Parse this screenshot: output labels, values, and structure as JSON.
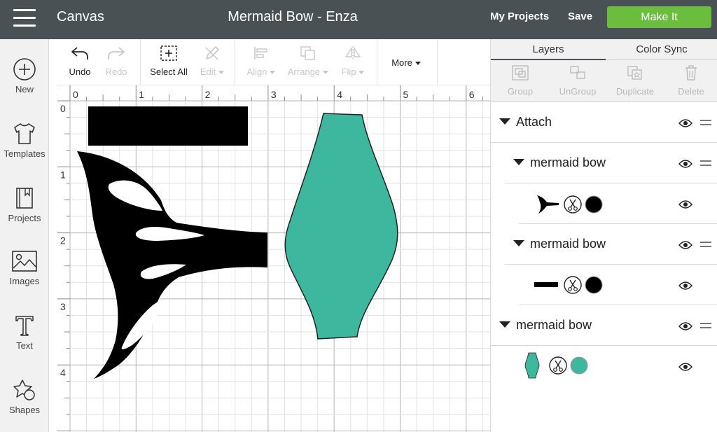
{
  "topbar": {
    "app_title": "Canvas",
    "project_title": "Mermaid Bow - Enza",
    "my_projects": "My Projects",
    "save": "Save",
    "make_it": "Make It"
  },
  "leftbar": {
    "items": [
      {
        "label": "New",
        "icon": "plus-circle-icon"
      },
      {
        "label": "Templates",
        "icon": "tshirt-icon"
      },
      {
        "label": "Projects",
        "icon": "book-icon"
      },
      {
        "label": "Images",
        "icon": "image-icon"
      },
      {
        "label": "Text",
        "icon": "text-icon"
      },
      {
        "label": "Shapes",
        "icon": "shapes-icon"
      }
    ]
  },
  "toolbar": {
    "undo": "Undo",
    "redo": "Redo",
    "select_all": "Select All",
    "edit": "Edit",
    "align": "Align",
    "arrange": "Arrange",
    "flip": "Flip",
    "more": "More"
  },
  "rulers": {
    "top": [
      "0",
      "1",
      "2",
      "3",
      "4",
      "5",
      "6"
    ],
    "left": [
      "0",
      "1",
      "2",
      "3",
      "4"
    ]
  },
  "layers_panel": {
    "tabs": [
      "Layers",
      "Color Sync"
    ],
    "actions": [
      "Group",
      "UnGroup",
      "Duplicate",
      "Delete"
    ],
    "rows": [
      {
        "title": "Attach"
      },
      {
        "title": "mermaid bow"
      },
      {
        "title": "mermaid bow"
      },
      {
        "title": "mermaid bow"
      }
    ],
    "layer_colors": {
      "tail": "#000000",
      "bar": "#000000",
      "bow": "#3db89e"
    }
  },
  "colors": {
    "topbar": "#4a5155",
    "make_it": "#6bbd3d",
    "teal_shape": "#3db89e"
  }
}
